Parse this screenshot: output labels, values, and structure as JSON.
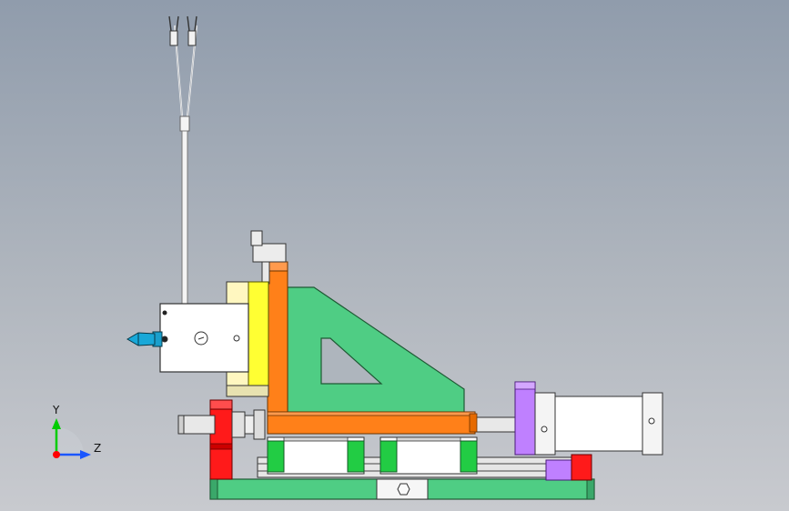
{
  "triad": {
    "x_label": "",
    "y_label": "Y",
    "z_label": "Z"
  },
  "colors": {
    "background_top": "#909cac",
    "background_bottom": "#c8cacf",
    "gusset": "#4fcd84",
    "frame_orange": "#ff8019",
    "clamp_yellow": "#ffff33",
    "stop_red": "#ff1a1a",
    "mount_purple": "#bf80ff",
    "rail_green": "#22cc44",
    "nozzle_cyan": "#18a8d8",
    "body_white": "#ffffff",
    "axis_x": "#ff0000",
    "axis_y": "#00cc00",
    "axis_z": "#1a56ff"
  }
}
